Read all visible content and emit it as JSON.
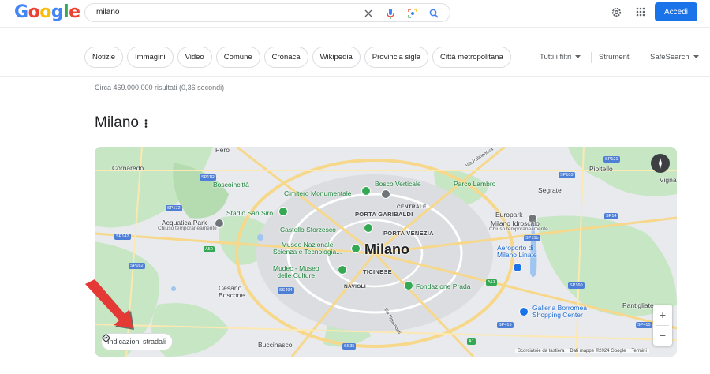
{
  "header": {
    "logo_text": "Google",
    "search_value": "milano",
    "signin_label": "Accedi",
    "icons": [
      "clear-icon",
      "mic-icon",
      "lens-icon",
      "search-icon",
      "settings-icon",
      "apps-icon"
    ]
  },
  "chips": [
    "Notizie",
    "Immagini",
    "Video",
    "Comune",
    "Cronaca",
    "Wikipedia",
    "Provincia sigla",
    "Città metropolitana"
  ],
  "tools": {
    "filters": "Tutti i filtri",
    "tools": "Strumenti",
    "safesearch": "SafeSearch"
  },
  "stats": "Circa 469.000.000 risultati (0,36 secondi)",
  "knowledge_panel": {
    "title": "Milano"
  },
  "map": {
    "places": {
      "pero": "Pero",
      "cornaredo": "Cornaredo",
      "boscoincitta": "Boscoincittà",
      "cimitero": "Cimitero Monumentale",
      "bosco_verticale": "Bosco Verticale",
      "parco_lambro": "Parco Lambro",
      "pioltello": "Pioltello",
      "vignate": "Vigna",
      "segrate": "Segrate",
      "stadio": "Stadio San Siro",
      "porta_garibaldi": "PORTA GARIBALDI",
      "centrale": "CENTRALE",
      "acquatica": "Acquatica Park",
      "acquatica_sub": "Chiuso temporaneamente",
      "castello": "Castello Sforzesco",
      "porta_venezia": "PORTA VENEZIA",
      "europark": "Europark",
      "idroscalo": "Milano Idroscalo",
      "idroscalo_sub": "Chiuso temporaneamente",
      "museo_naz": "Museo Nazionale\nScienza e Tecnologia...",
      "city": "Milano",
      "aeroporto": "Aeroporto di\nMilano Linate",
      "mudec": "Mudec - Museo\ndelle Culture",
      "ticinese": "TICINESE",
      "navigli": "NAVIGLI",
      "fondazione": "Fondazione Prada",
      "cesano": "Cesano\nBoscone",
      "pantigliate": "Pantigliate",
      "galleria": "Galleria Borromea\nShopping Center",
      "buccinasco": "Buccinasco",
      "via_palmanova": "Via Palmanova",
      "via_ripamonti": "Via Ripamonti"
    },
    "roads": [
      "SP11R",
      "SP172",
      "SP142",
      "SP162",
      "A50",
      "SS494",
      "SS35",
      "SP103",
      "SP121",
      "SP14",
      "SP15b",
      "A51",
      "SP160",
      "SP415",
      "SP415",
      "A1"
    ],
    "directions_label": "Indicazioni stradali",
    "attribution": {
      "shortcuts": "Scorciatoie da tastiera",
      "data": "Dati mappe ©2024 Google",
      "terms": "Termini"
    },
    "zoom_in": "+",
    "zoom_out": "−"
  }
}
